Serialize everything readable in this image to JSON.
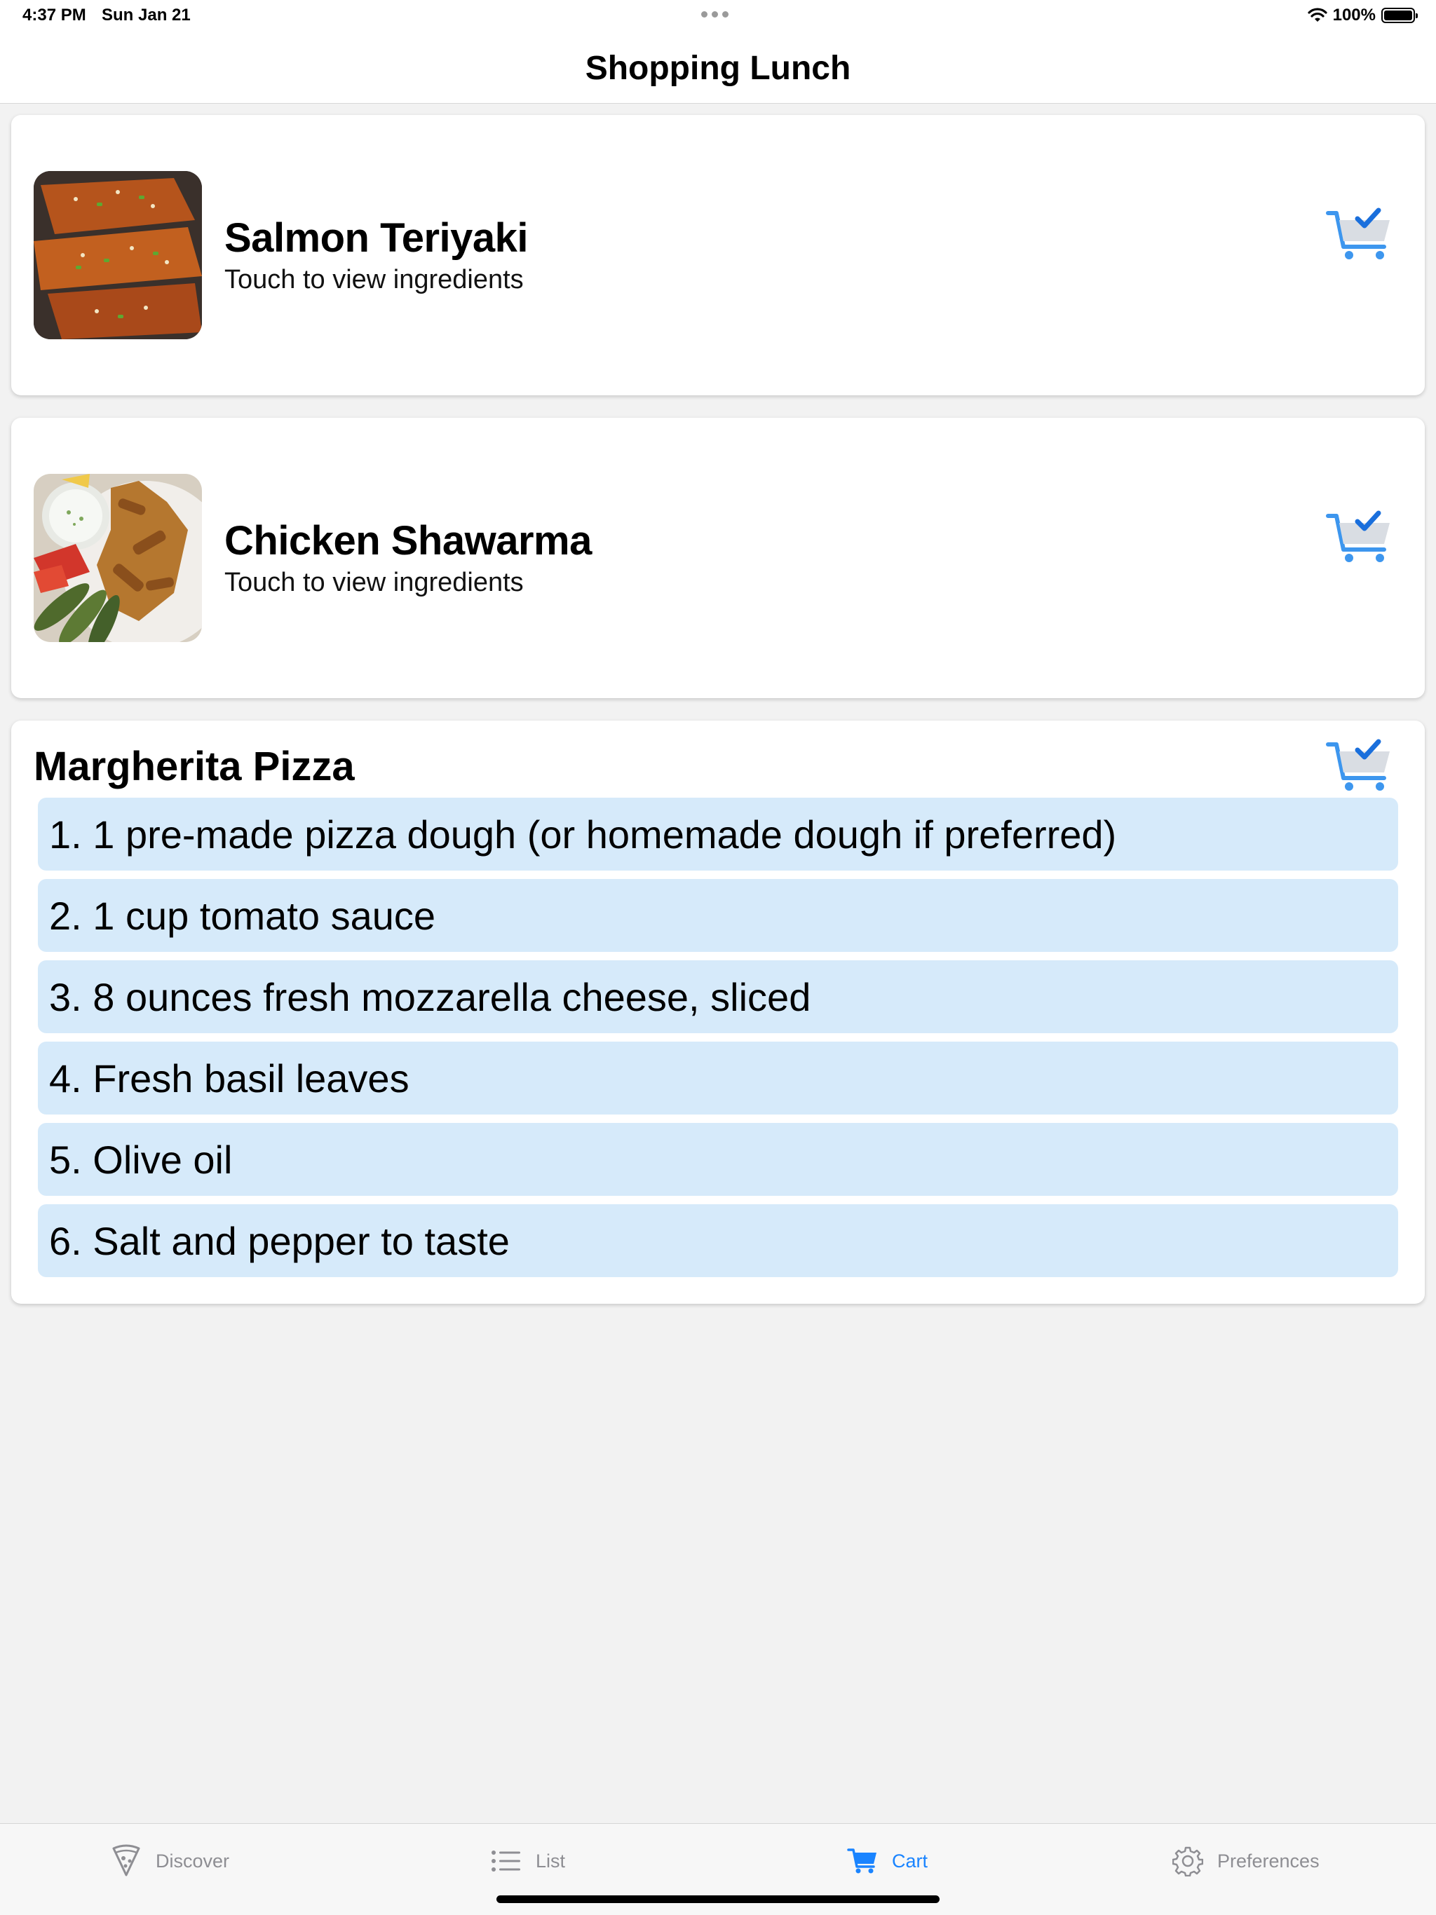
{
  "status": {
    "time": "4:37 PM",
    "date": "Sun Jan 21",
    "battery": "100%"
  },
  "nav": {
    "title": "Shopping Lunch"
  },
  "recipes": [
    {
      "name": "Salmon Teriyaki",
      "subtitle": "Touch to view ingredients",
      "icon": "salmon-photo",
      "in_cart": true
    },
    {
      "name": "Chicken Shawarma",
      "subtitle": "Touch to view ingredients",
      "icon": "shawarma-photo",
      "in_cart": true
    }
  ],
  "expanded": {
    "name": "Margherita Pizza",
    "in_cart": true,
    "ingredients": [
      "1. 1 pre-made pizza dough (or homemade dough if preferred)",
      "2. 1 cup tomato sauce",
      "3. 8 ounces fresh mozzarella cheese, sliced",
      "4. Fresh basil leaves",
      "5. Olive oil",
      "6. Salt and pepper to taste"
    ]
  },
  "tabs": [
    {
      "label": "Discover",
      "icon": "pizza-slice-icon",
      "active": false
    },
    {
      "label": "List",
      "icon": "list-icon",
      "active": false
    },
    {
      "label": "Cart",
      "icon": "cart-icon",
      "active": true
    },
    {
      "label": "Preferences",
      "icon": "gear-icon",
      "active": false
    }
  ],
  "colors": {
    "accent": "#1a84ff",
    "ingredient_bg": "#d6eafa",
    "background": "#f2f2f2"
  }
}
